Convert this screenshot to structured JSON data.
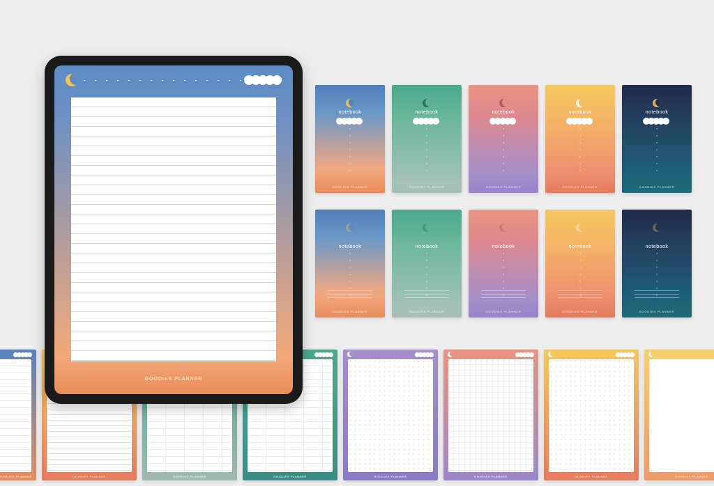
{
  "brand": "GOODIES PLANNER",
  "cover_label": "notebook",
  "gradients": [
    "blue",
    "green",
    "pink",
    "orange",
    "navy"
  ],
  "bottom_pages": [
    {
      "grad": "blue",
      "pattern": "2col",
      "partial": true
    },
    {
      "grad": "orange",
      "pattern": "lined"
    },
    {
      "grad": "green",
      "pattern": "table"
    },
    {
      "grad": "teal",
      "pattern": "table"
    },
    {
      "grad": "purple",
      "pattern": "dot"
    },
    {
      "grad": "pink",
      "pattern": "grid"
    },
    {
      "grad": "orange",
      "pattern": "dot"
    },
    {
      "grad": "yellow",
      "pattern": "blank"
    },
    {
      "grad": "navy",
      "pattern": "cornell"
    },
    {
      "grad": "navy",
      "pattern": "half"
    }
  ]
}
